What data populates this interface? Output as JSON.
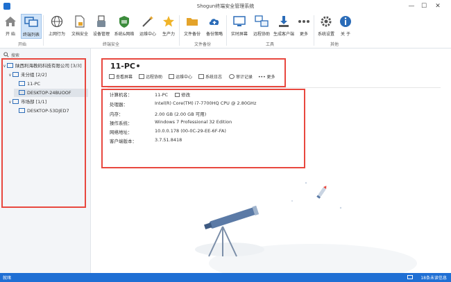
{
  "window": {
    "title": "Shogun终端安全管理系统",
    "controls": {
      "min": "—",
      "max": "☐",
      "close": "✕"
    }
  },
  "ribbon": {
    "buttons": [
      {
        "label": "开 始",
        "icon": "home-icon"
      },
      {
        "label": "终端列表",
        "icon": "terminal-list-icon",
        "active": true
      },
      {
        "label": "上网行为",
        "icon": "globe-icon"
      },
      {
        "label": "文档安全",
        "icon": "document-lock-icon"
      },
      {
        "label": "设备管理",
        "icon": "usb-icon"
      },
      {
        "label": "系统&网络",
        "icon": "firewall-icon"
      },
      {
        "label": "运维中心",
        "icon": "wand-icon"
      },
      {
        "label": "生产力",
        "icon": "star-icon"
      },
      {
        "label": "文件备份",
        "icon": "folder-icon"
      },
      {
        "label": "备份策略",
        "icon": "cloud-upload-icon"
      },
      {
        "label": "实时屏幕",
        "icon": "monitor-icon"
      },
      {
        "label": "远程协助",
        "icon": "remote-icon"
      },
      {
        "label": "生成客户端",
        "icon": "download-icon"
      },
      {
        "label": "更多",
        "icon": "more-icon"
      },
      {
        "label": "系统设置",
        "icon": "gear-icon"
      },
      {
        "label": "关 于",
        "icon": "info-icon"
      }
    ],
    "groups": [
      "开始",
      "终端安全",
      "文件备份",
      "工具",
      "其他"
    ]
  },
  "sidebar": {
    "search_placeholder": "搜索",
    "tree": [
      {
        "label": "陕西利海教码科技有限公司",
        "count": "[3/3]"
      },
      {
        "label": "未分组",
        "count": "[2/2]"
      },
      {
        "label": "11-PC"
      },
      {
        "label": "DESKTOP-24BUOOF"
      },
      {
        "label": "市场部",
        "count": "[1/1]"
      },
      {
        "label": "DESKTOP-53DJED7"
      }
    ]
  },
  "detail": {
    "name": "11-PC",
    "actions": [
      "查看屏幕",
      "远程协助",
      "运维中心",
      "系统日志",
      "审计记录",
      "更多"
    ],
    "fields": [
      {
        "label": "计算机名：",
        "value": "11-PC",
        "extra": "修改"
      },
      {
        "label": "处理器：",
        "value": "Intel(R) Core(TM) i7-7700HQ CPU @ 2.80GHz"
      },
      {
        "label": "内存：",
        "value": "2.00 GB (2.00 GB 可用)"
      },
      {
        "label": "操作系统：",
        "value": "Windows 7 Professional 32 Edition"
      },
      {
        "label": "网络地址：",
        "value": "10.0.0.178  (00-0C-29-EE-6F-FA)"
      },
      {
        "label": "客户端版本：",
        "value": "3.7.51.8418"
      }
    ]
  },
  "status": {
    "left": "就绪",
    "right": "18条未读信息"
  },
  "colors": {
    "accent": "#1f6fd4",
    "highlight": "#e8473e"
  }
}
